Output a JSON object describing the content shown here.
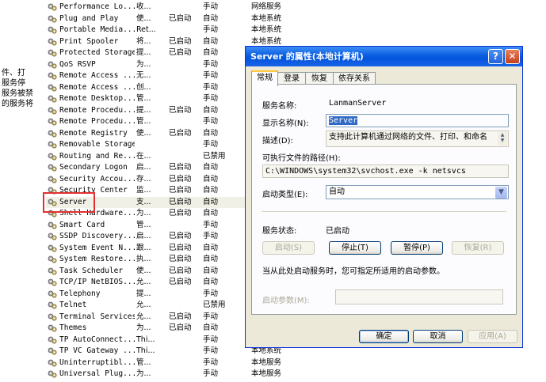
{
  "left_description": [
    "件、打",
    "服务停",
    "服务被禁",
    "的服务将"
  ],
  "services": [
    {
      "name": "Performance Lo...",
      "desc": "收...",
      "status": "",
      "startup": "手动",
      "logon": "网络服务"
    },
    {
      "name": "Plug and Play",
      "desc": "使...",
      "status": "已启动",
      "startup": "自动",
      "logon": "本地系统"
    },
    {
      "name": "Portable Media...",
      "desc": "Ret...",
      "status": "",
      "startup": "手动",
      "logon": "本地系统"
    },
    {
      "name": "Print Spooler",
      "desc": "将...",
      "status": "已启动",
      "startup": "自动",
      "logon": "本地系统"
    },
    {
      "name": "Protected Storage",
      "desc": "提...",
      "status": "已启动",
      "startup": "自动",
      "logon": ""
    },
    {
      "name": "QoS RSVP",
      "desc": "为...",
      "status": "",
      "startup": "手动",
      "logon": ""
    },
    {
      "name": "Remote Access ...",
      "desc": "无...",
      "status": "",
      "startup": "手动",
      "logon": ""
    },
    {
      "name": "Remote Access ...",
      "desc": "创...",
      "status": "",
      "startup": "手动",
      "logon": ""
    },
    {
      "name": "Remote Desktop...",
      "desc": "管...",
      "status": "",
      "startup": "手动",
      "logon": ""
    },
    {
      "name": "Remote Procedu...",
      "desc": "提...",
      "status": "已启动",
      "startup": "自动",
      "logon": ""
    },
    {
      "name": "Remote Procedu...",
      "desc": "管...",
      "status": "",
      "startup": "手动",
      "logon": ""
    },
    {
      "name": "Remote Registry",
      "desc": "使...",
      "status": "已启动",
      "startup": "自动",
      "logon": ""
    },
    {
      "name": "Removable Storage",
      "desc": "",
      "status": "",
      "startup": "手动",
      "logon": ""
    },
    {
      "name": "Routing and Re...",
      "desc": "在...",
      "status": "",
      "startup": "已禁用",
      "logon": ""
    },
    {
      "name": "Secondary Logon",
      "desc": "启...",
      "status": "已启动",
      "startup": "自动",
      "logon": ""
    },
    {
      "name": "Security Accou...",
      "desc": "存...",
      "status": "已启动",
      "startup": "自动",
      "logon": ""
    },
    {
      "name": "Security Center",
      "desc": "监...",
      "status": "已启动",
      "startup": "自动",
      "logon": ""
    },
    {
      "name": "Server",
      "desc": "支...",
      "status": "已启动",
      "startup": "自动",
      "logon": ""
    },
    {
      "name": "Shell Hardware...",
      "desc": "为...",
      "status": "已启动",
      "startup": "自动",
      "logon": ""
    },
    {
      "name": "Smart Card",
      "desc": "管...",
      "status": "",
      "startup": "手动",
      "logon": ""
    },
    {
      "name": "SSDP Discovery...",
      "desc": "启...",
      "status": "已启动",
      "startup": "手动",
      "logon": ""
    },
    {
      "name": "System Event N...",
      "desc": "跟...",
      "status": "已启动",
      "startup": "自动",
      "logon": ""
    },
    {
      "name": "System Restore...",
      "desc": "执...",
      "status": "已启动",
      "startup": "自动",
      "logon": ""
    },
    {
      "name": "Task Scheduler",
      "desc": "使...",
      "status": "已启动",
      "startup": "自动",
      "logon": ""
    },
    {
      "name": "TCP/IP NetBIOS...",
      "desc": "允...",
      "status": "已启动",
      "startup": "自动",
      "logon": ""
    },
    {
      "name": "Telephony",
      "desc": "提...",
      "status": "",
      "startup": "手动",
      "logon": ""
    },
    {
      "name": "Telnet",
      "desc": "允...",
      "status": "",
      "startup": "已禁用",
      "logon": ""
    },
    {
      "name": "Terminal Services",
      "desc": "允...",
      "status": "已启动",
      "startup": "手动",
      "logon": ""
    },
    {
      "name": "Themes",
      "desc": "为...",
      "status": "已启动",
      "startup": "自动",
      "logon": ""
    },
    {
      "name": "TP AutoConnect...",
      "desc": "Thi...",
      "status": "",
      "startup": "手动",
      "logon": ""
    },
    {
      "name": "TP VC Gateway ...",
      "desc": "Thi...",
      "status": "",
      "startup": "手动",
      "logon": "本地系统"
    },
    {
      "name": "Uninterruptibl...",
      "desc": "管...",
      "status": "",
      "startup": "手动",
      "logon": "本地服务"
    },
    {
      "name": "Universal Plug...",
      "desc": "为...",
      "status": "",
      "startup": "手动",
      "logon": "本地服务"
    }
  ],
  "dialog": {
    "title": "Server 的属性(本地计算机)",
    "help_label": "?",
    "close_label": "✕",
    "tabs": [
      "常规",
      "登录",
      "恢复",
      "依存关系"
    ],
    "service_name_label": "服务名称:",
    "service_name": "LanmanServer",
    "display_name_label": "显示名称(N):",
    "display_name": "Server",
    "description_label": "描述(D):",
    "description": "支持此计算机通过网络的文件、打印、和命名",
    "exe_path_label": "可执行文件的路径(H):",
    "exe_path": "C:\\WINDOWS\\system32\\svchost.exe -k netsvcs",
    "startup_type_label": "启动类型(E):",
    "startup_type": "自动",
    "status_label": "服务状态:",
    "status": "已启动",
    "start_button": "启动(S)",
    "stop_button": "停止(T)",
    "pause_button": "暂停(P)",
    "resume_button": "恢复(R)",
    "hint": "当从此处启动服务时，您可指定所适用的启动参数。",
    "params_label": "启动参数(M):",
    "params_value": "",
    "ok_button": "确定",
    "cancel_button": "取消",
    "apply_button": "应用(A)"
  }
}
